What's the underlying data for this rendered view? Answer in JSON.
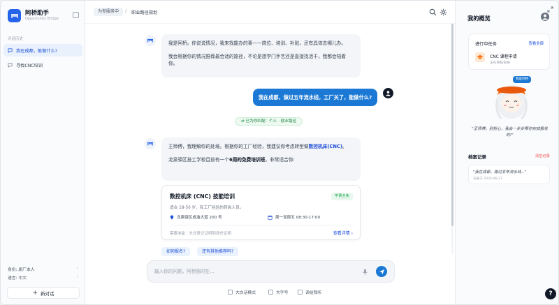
{
  "sidebar": {
    "brand_name": "阿桥助手",
    "brand_sub": "Opportunity Bridge",
    "history_label": "对话历史",
    "conversations": [
      {
        "label": "我在成都，能做什么?"
      },
      {
        "label": "寻找CNC培训"
      }
    ],
    "identity_label": "身份: 原厂本人",
    "language_label": "语言: 中文",
    "new_chat_label": "新对话"
  },
  "topbar": {
    "crumb_tag": "为你服务中",
    "crumb_sep": "/",
    "crumb_current": "职业路径规划"
  },
  "chat": {
    "ai_intro_1": "我是阿桥。你说说情况，我来找能办的事——岗位、培训、补贴，还有具体去哪儿办。",
    "ai_intro_2": "我会根据你的情况推荐最合适的路径，不论是想学门手艺还是直接找活干，我都会陪着你。",
    "user_msg": "我在成都，做过五年流水线，工厂关了，能做什么?",
    "match_pill": "已为你匹配：个人 · 就业路径",
    "ai_reply_1a": "王师傅，我理解你的处境。根据你的工厂经验，我建议你考虑转型做",
    "ai_reply_1_highlight": "数控机床(CNC)",
    "ai_reply_1b": "。",
    "ai_reply_2a": "龙泉驿区技工学校目前有一个",
    "ai_reply_2_strong": "6周的免费培训班",
    "ai_reply_2b": "，非常适合你:",
    "course": {
      "title": "数控机床 (CNC) 技能培训",
      "badge": "学费全免",
      "desc": "适合 18-50 岁，有工厂经验的转岗人员。",
      "location": "龙泉驿区成渝大道 200 号",
      "schedule": "周一至周五 08:30-17:00",
      "prep": "需要准备：失业登记证明和身份证明",
      "link": "查看详情 ›"
    },
    "quick_replies": [
      "如何报名?",
      "还有其他推荐吗?"
    ]
  },
  "composer": {
    "placeholder": "输入你的问题，阿桥随时在...",
    "options": [
      "大白话模式",
      "大字号",
      "读给我听"
    ]
  },
  "right_panel": {
    "title": "我的概览",
    "task_head": "进行中任务",
    "task_all": "查看全部",
    "task_name": "CNC 课程申请",
    "task_sub": "正在审核资格",
    "mascot_badge": "我是阿桥",
    "mascot_quote": "\"王师傅，别担心，我会一步步帮你完成报名的!\"",
    "history_title": "档案记录",
    "history_clear": "清空记录",
    "history_text": "\"我在成都，做过五年流水线...\"",
    "history_date": "记录于 2024-06-27"
  },
  "colors": {
    "accent": "#1b78d4",
    "brand": "#2563eb",
    "success": "#16a34a"
  }
}
